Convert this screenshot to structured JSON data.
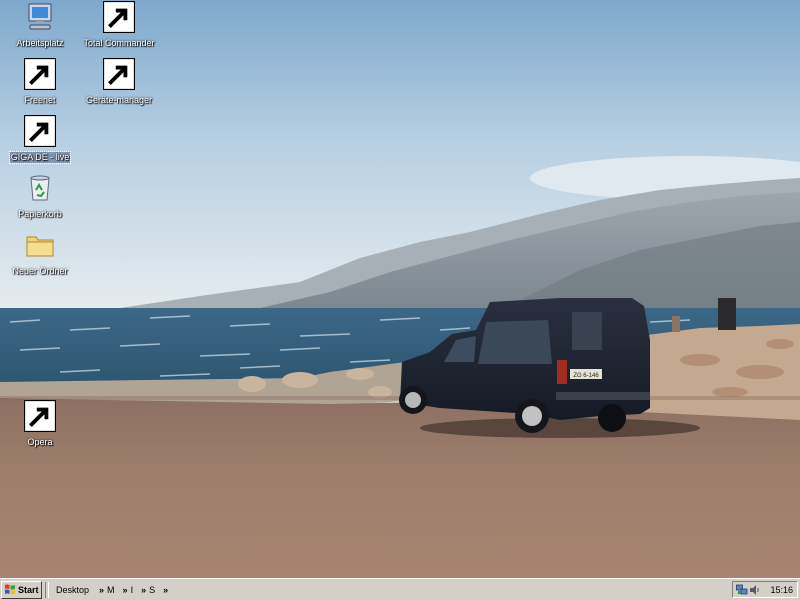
{
  "desktop": {
    "icons": [
      {
        "label": "Arbeitsplatz",
        "icon": "my-computer-icon"
      },
      {
        "label": "Total Commander",
        "icon": "floppy-disk-icon"
      },
      {
        "label": "Freenet",
        "icon": "network-globe-icon"
      },
      {
        "label": "Geräte-manager",
        "icon": "device-manager-icon"
      },
      {
        "label": "GIGA DE - live",
        "icon": "media-player-icon"
      },
      {
        "label": "Papierkorb",
        "icon": "recycle-bin-icon"
      },
      {
        "label": "Neuer Ordner",
        "icon": "folder-icon"
      },
      {
        "label": "Opera",
        "icon": "opera-icon"
      }
    ],
    "wallpaper": "coastal-road-with-van-photo",
    "van_plate": "ZG 6-146"
  },
  "taskbar": {
    "start_label": "Start",
    "toolbar_title": "Desktop",
    "quick_launch": [
      "M",
      "I",
      "S"
    ],
    "clock": "15:16",
    "tray_icons": [
      "network-icon",
      "volume-icon"
    ],
    "colors": {
      "face": "#d4d0c8",
      "highlight": "#ffffff",
      "shadow": "#808080"
    }
  }
}
